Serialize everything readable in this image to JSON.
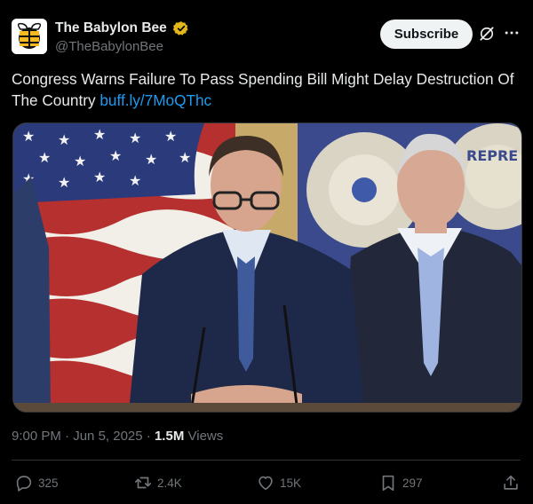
{
  "account": {
    "display_name": "The Babylon Bee",
    "handle": "@TheBabylonBee",
    "avatar_icon": "babylon-bee-logo",
    "verified_icon": "gold-verified-badge"
  },
  "header": {
    "subscribe_label": "Subscribe",
    "grok_icon": "grok-icon",
    "more_icon": "more-icon"
  },
  "post": {
    "text": "Congress Warns Failure To Pass Spending Bill Might Delay Destruction Of The Country",
    "link": "buff.ly/7MoQThc"
  },
  "meta": {
    "time": "9:00 PM",
    "separator": "·",
    "date": "Jun 5, 2025",
    "views_count": "1.5M",
    "views_label": "Views"
  },
  "actions": {
    "replies": "325",
    "reposts": "2.4K",
    "likes": "15K",
    "bookmarks": "297"
  },
  "colors": {
    "background": "#000000",
    "text": "#e7e9ea",
    "secondary": "#71767b",
    "link": "#1d9bf0",
    "divider": "#2f3336",
    "verified_gold": "#e2b719"
  }
}
